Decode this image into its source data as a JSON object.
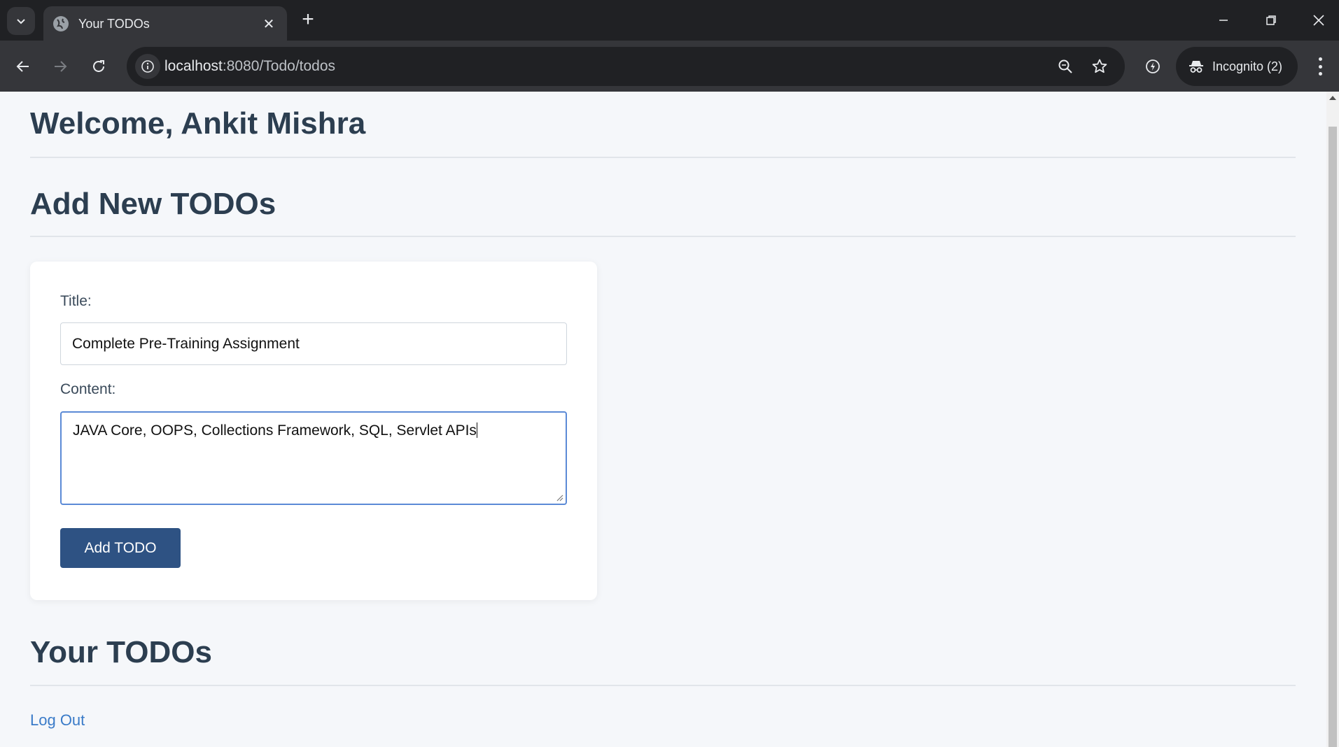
{
  "browser": {
    "tab_title": "Your TODOs",
    "tab_close": "✕",
    "new_tab": "+",
    "url_host": "localhost",
    "url_path": ":8080/Todo/todos",
    "incognito_label": "Incognito (2)",
    "icons": {
      "tab_list": "chevron-down-icon",
      "favicon": "globe-icon",
      "back": "arrow-left-icon",
      "forward": "arrow-right-icon",
      "reload": "reload-icon",
      "site_info": "info-icon",
      "zoom": "zoom-icon",
      "bookmark": "star-icon",
      "performance": "performance-icon",
      "incognito": "incognito-icon",
      "menu": "more-vert-icon",
      "minimize": "minimize-icon",
      "restore": "restore-icon",
      "close": "close-icon"
    }
  },
  "page": {
    "welcome": "Welcome, Ankit Mishra",
    "add_heading": "Add New TODOs",
    "form": {
      "title_label": "Title:",
      "title_value": "Complete Pre-Training Assignment",
      "content_label": "Content:",
      "content_value": "JAVA Core, OOPS, Collections Framework, SQL, Servlet APIs",
      "submit_label": "Add TODO"
    },
    "list_heading": "Your TODOs",
    "logout_label": "Log Out"
  },
  "colors": {
    "heading": "#2c3e50",
    "button": "#2e5283",
    "link": "#3a7bc8",
    "focus_border": "#5b8ad6"
  }
}
